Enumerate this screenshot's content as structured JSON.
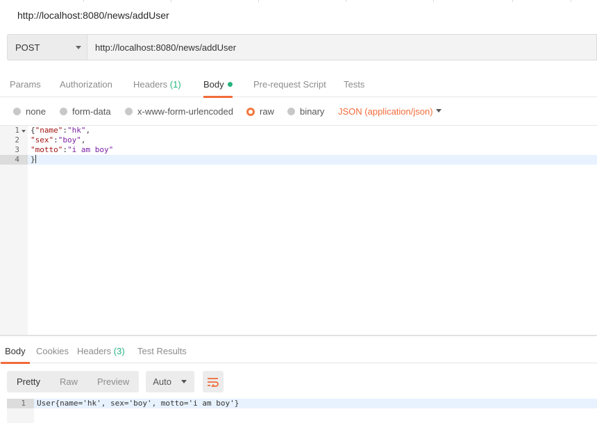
{
  "request": {
    "name": "http://localhost:8080/news/addUser",
    "method": "POST",
    "url": "http://localhost:8080/news/addUser"
  },
  "request_tabs": {
    "params": "Params",
    "authorization": "Authorization",
    "headers": "Headers",
    "headers_count": "(1)",
    "body": "Body",
    "prerequest": "Pre-request Script",
    "tests": "Tests"
  },
  "body_options": {
    "none": "none",
    "form_data": "form-data",
    "urlencoded": "x-www-form-urlencoded",
    "raw": "raw",
    "binary": "binary",
    "content_type": "JSON (application/json)",
    "selected": "raw"
  },
  "editor": {
    "line_numbers": [
      "1",
      "2",
      "3",
      "4"
    ],
    "line1": {
      "open": "{",
      "key": "\"name\"",
      "colon": ":",
      "value": "\"hk\"",
      "comma": ","
    },
    "line2": {
      "key": "\"sex\"",
      "colon": ":",
      "value": "\"boy\"",
      "comma": ","
    },
    "line3": {
      "key": "\"motto\"",
      "colon": ":",
      "value": "\"i am boy\""
    },
    "line4": {
      "close": "}"
    }
  },
  "response_tabs": {
    "body": "Body",
    "cookies": "Cookies",
    "headers": "Headers",
    "headers_count": "(3)",
    "test_results": "Test Results"
  },
  "response_toolbar": {
    "pretty": "Pretty",
    "raw": "Raw",
    "preview": "Preview",
    "format": "Auto"
  },
  "response": {
    "line_number": "1",
    "text": "User{name='hk', sex='boy', motto='i am boy'}"
  },
  "colors": {
    "accent": "#f26b3a",
    "green": "#26b47f"
  },
  "icons": {
    "method_dropdown": "chevron-down-icon",
    "content_type_dropdown": "chevron-down-icon",
    "format_dropdown": "chevron-down-icon",
    "wrap": "wrap-lines-icon",
    "fold": "fold-arrow-icon"
  }
}
